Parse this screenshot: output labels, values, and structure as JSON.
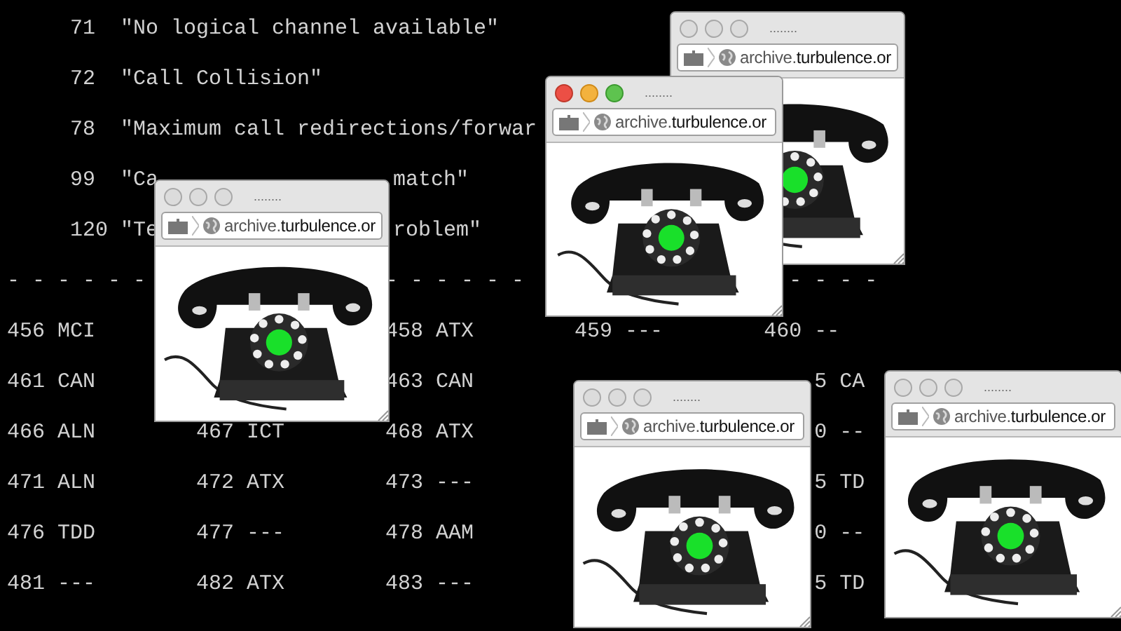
{
  "terminal": {
    "messages": [
      {
        "code": "71",
        "fragments": [
          "\"No logical channel available\""
        ]
      },
      {
        "code": "72",
        "fragments": [
          "\"Call Collision\""
        ]
      },
      {
        "code": "78",
        "fragments": [
          "\"Maximum call redirections/forwar"
        ]
      },
      {
        "code": "99",
        "fragments": [
          "\"Ca",
          "match\""
        ]
      },
      {
        "code": "120",
        "fragments": [
          "\"Te",
          "roblem\""
        ]
      }
    ],
    "rule": [
      "- - - - - -",
      "- - - - - -",
      "- - - -"
    ],
    "rows": [
      {
        "column_1": "456 MCI",
        "column_3": "458 ATX",
        "column_4": "459 ---",
        "column_5": "460 --"
      },
      {
        "column_1": "461 CAN",
        "column_3": "463 CAN",
        "column_5": "5 CA"
      },
      {
        "column_1": "466 ALN",
        "column_2": "467 ICT",
        "column_3": "468 ATX",
        "column_5": "0 --"
      },
      {
        "column_1": "471 ALN",
        "column_2": "472 ATX",
        "column_3": "473 ---",
        "column_5": "5 TD"
      },
      {
        "column_1": "476 TDD",
        "column_2": "477 ---",
        "column_3": "478 AAM",
        "column_5": "0 --"
      },
      {
        "column_1": "481 ---",
        "column_2": "482 ATX",
        "column_3": "483 ---",
        "column_5": "5 TD"
      }
    ]
  },
  "windows": [
    {
      "title": "........",
      "url": "archive.**turbulence.or**",
      "active": false
    },
    {
      "title": "........",
      "url": "archive.**turbulence.or**",
      "active": false
    },
    {
      "title": "........",
      "url": "archive.**turbulence.or**",
      "active": true
    },
    {
      "title": "........",
      "url": "archive.**turbulence.or**",
      "active": false
    },
    {
      "title": "........",
      "url": "archive.**turbulence.or**",
      "active": false
    }
  ]
}
